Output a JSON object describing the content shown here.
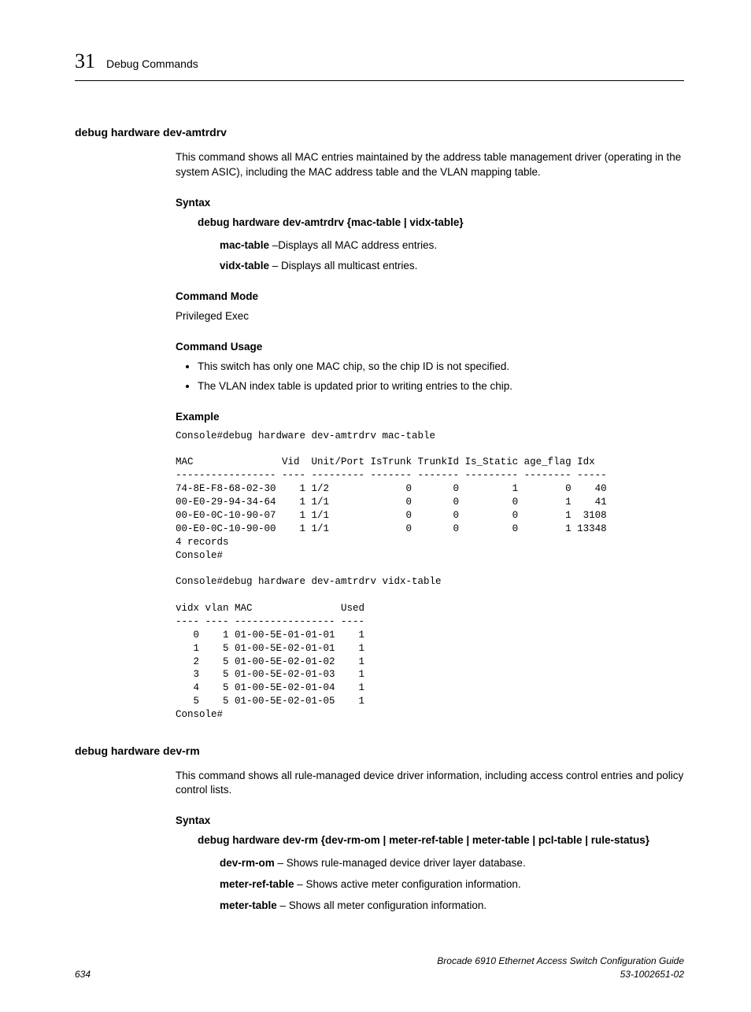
{
  "header": {
    "chapter_num": "31",
    "chapter_title": "Debug Commands"
  },
  "section1": {
    "cmd_name": "debug hardware dev-amtrdrv",
    "description": "This command shows all MAC entries maintained by the address table management driver (operating in the system ASIC), including the MAC address table and the VLAN mapping table.",
    "syntax_heading": "Syntax",
    "syntax_line": "debug hardware dev-amtrdrv {mac-table | vidx-table}",
    "params": [
      {
        "bold": "mac-table",
        "rest": " –Displays all MAC address entries."
      },
      {
        "bold": "vidx-table",
        "rest": " – Displays all multicast entries."
      }
    ],
    "mode_heading": "Command Mode",
    "mode_text": "Privileged Exec",
    "usage_heading": "Command Usage",
    "usage": [
      "This switch has only one MAC chip, so the chip ID is not specified.",
      "The VLAN index table is updated prior to writing entries to the chip."
    ],
    "example_heading": "Example",
    "example_text": "Console#debug hardware dev-amtrdrv mac-table\n\nMAC               Vid  Unit/Port IsTrunk TrunkId Is_Static age_flag Idx\n----------------- ---- --------- ------- ------- --------- -------- -----\n74-8E-F8-68-02-30    1 1/2             0       0         1        0    40\n00-E0-29-94-34-64    1 1/1             0       0         0        1    41\n00-E0-0C-10-90-07    1 1/1             0       0         0        1  3108\n00-E0-0C-10-90-00    1 1/1             0       0         0        1 13348\n4 records\nConsole#\n\nConsole#debug hardware dev-amtrdrv vidx-table\n\nvidx vlan MAC               Used\n---- ---- ----------------- ----\n   0    1 01-00-5E-01-01-01    1\n   1    5 01-00-5E-02-01-01    1\n   2    5 01-00-5E-02-01-02    1\n   3    5 01-00-5E-02-01-03    1\n   4    5 01-00-5E-02-01-04    1\n   5    5 01-00-5E-02-01-05    1\nConsole#"
  },
  "section2": {
    "cmd_name": "debug hardware dev-rm",
    "description": "This command shows all rule-managed device driver information, including access control entries and policy control lists.",
    "syntax_heading": "Syntax",
    "syntax_line": "debug hardware dev-rm {dev-rm-om | meter-ref-table | meter-table | pcl-table | rule-status}",
    "params": [
      {
        "bold": "dev-rm-om",
        "rest": " – Shows rule-managed device driver layer database."
      },
      {
        "bold": "meter-ref-table",
        "rest": " – Shows active meter configuration information."
      },
      {
        "bold": "meter-table",
        "rest": " – Shows all meter configuration information."
      }
    ]
  },
  "footer": {
    "page_num": "634",
    "doc_title": "Brocade 6910 Ethernet Access Switch Configuration Guide",
    "doc_id": "53-1002651-02"
  }
}
